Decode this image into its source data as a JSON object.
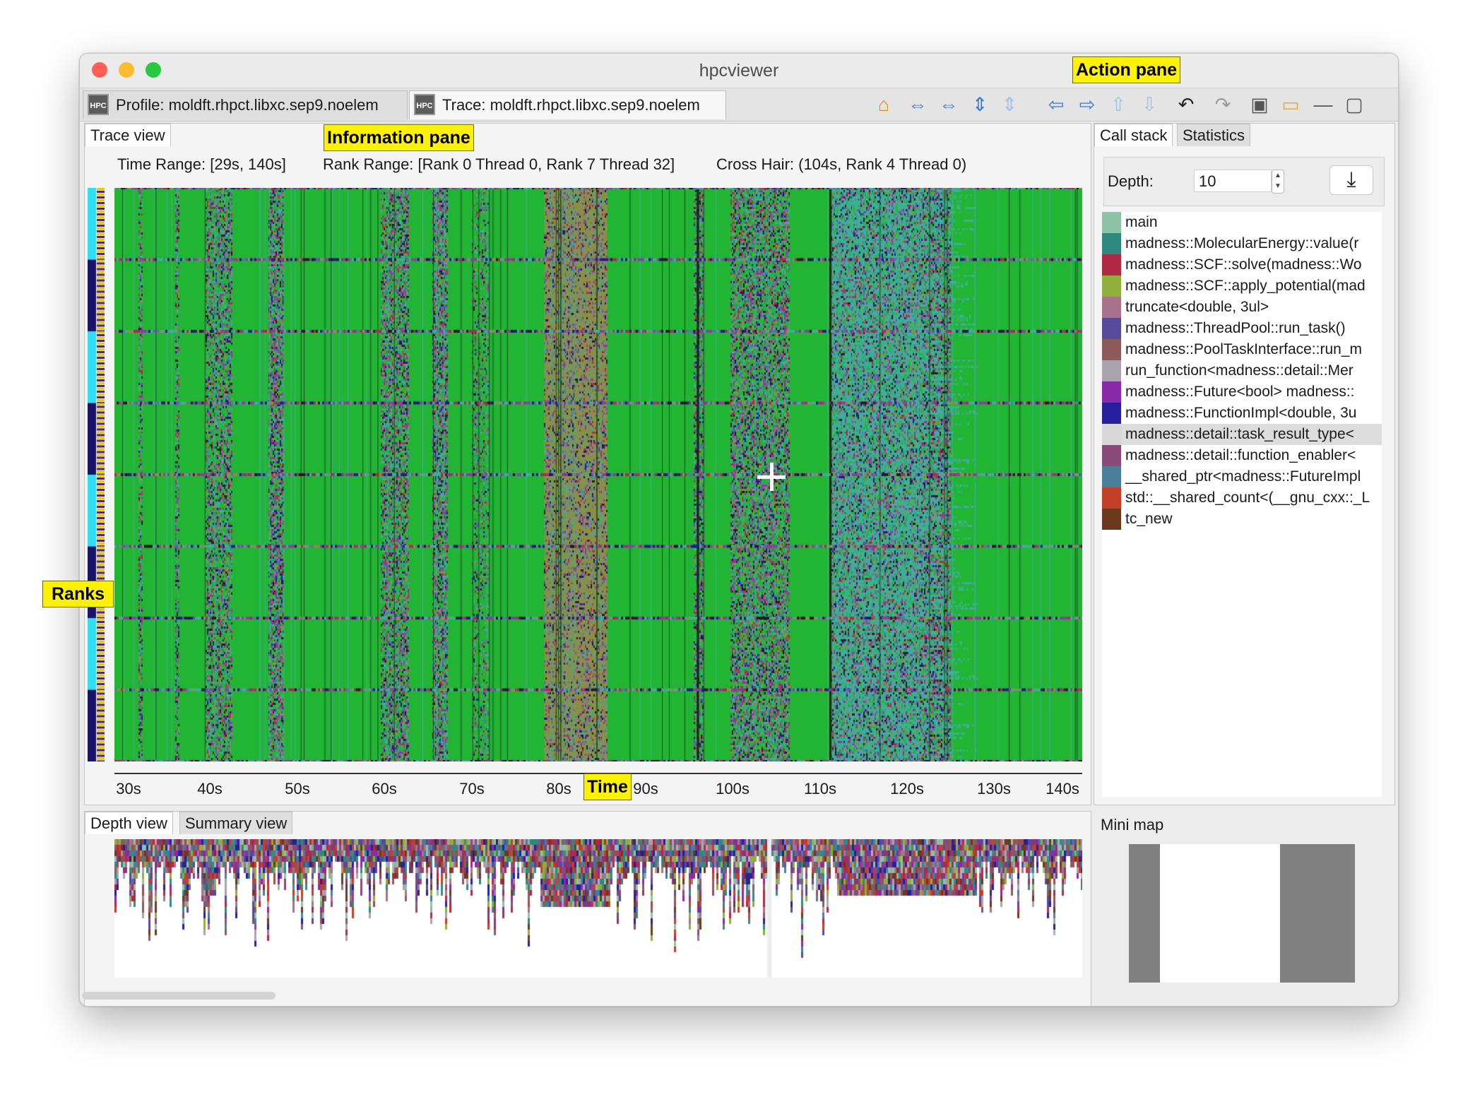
{
  "window": {
    "title": "hpcviewer",
    "traffic_lights": {
      "close": "#ff5f57",
      "minimize": "#febc2e",
      "zoom": "#28c840"
    }
  },
  "tabs": [
    {
      "label": "Profile: moldft.rhpct.libxc.sep9.noelem",
      "icon": "hpc-icon",
      "active": false
    },
    {
      "label": "Trace: moldft.rhpct.libxc.sep9.noelem",
      "icon": "hpc-icon",
      "active": true
    }
  ],
  "toolbar": {
    "buttons": [
      {
        "name": "home-icon"
      },
      {
        "name": "zoom-in-time-icon"
      },
      {
        "name": "zoom-out-time-icon"
      },
      {
        "name": "zoom-in-rank-icon"
      },
      {
        "name": "zoom-out-rank-icon"
      },
      {
        "name": "arrow-left-icon"
      },
      {
        "name": "arrow-right-icon"
      },
      {
        "name": "arrow-up-icon"
      },
      {
        "name": "arrow-down-icon"
      },
      {
        "name": "undo-icon"
      },
      {
        "name": "redo-icon"
      },
      {
        "name": "save-icon"
      },
      {
        "name": "open-folder-icon"
      },
      {
        "name": "minimize-icon"
      },
      {
        "name": "maximize-icon"
      }
    ]
  },
  "annotations": {
    "action_pane": "Action pane",
    "information_pane": "Information pane",
    "ranks": "Ranks",
    "time": "Time"
  },
  "trace_view": {
    "tab_label": "Trace view",
    "time_range": "Time Range: [29s, 140s]",
    "rank_range": "Rank Range: [Rank 0 Thread 0, Rank 7 Thread 32]",
    "cross_hair": "Cross Hair: (104s, Rank 4 Thread 0)",
    "x_ticks": [
      "30s",
      "40s",
      "50s",
      "60s",
      "70s",
      "80s",
      "90s",
      "100s",
      "110s",
      "120s",
      "130s",
      "140s"
    ],
    "colors": {
      "green": "#22b534",
      "olive": "#8a8f45",
      "teal": "#3fae98",
      "navy": "#221b8a",
      "purple": "#8a3fa0",
      "rank_cyan": "#2ee0f5",
      "rank_navy": "#1a1466"
    }
  },
  "bottom_panel": {
    "tabs": [
      "Depth view",
      "Summary view"
    ],
    "active_tab": "Depth view"
  },
  "call_stack": {
    "tabs": [
      "Call stack",
      "Statistics"
    ],
    "active_tab": "Call stack",
    "depth_label": "Depth:",
    "depth_value": "10",
    "items": [
      {
        "label": "main",
        "color": "#8ec3a8"
      },
      {
        "label": "madness::MolecularEnergy::value(r",
        "color": "#2e8a80"
      },
      {
        "label": "madness::SCF::solve(madness::Wo",
        "color": "#b02a45"
      },
      {
        "label": "madness::SCF::apply_potential(mad",
        "color": "#8fae3a"
      },
      {
        "label": "truncate<double, 3ul>",
        "color": "#a8728a"
      },
      {
        "label": "madness::ThreadPool::run_task()",
        "color": "#574a9a"
      },
      {
        "label": "madness::PoolTaskInterface::run_m",
        "color": "#8e5a5a"
      },
      {
        "label": "run_function<madness::detail::Mer",
        "color": "#a8a3ad"
      },
      {
        "label": "madness::Future<bool> madness::",
        "color": "#8a2aa8"
      },
      {
        "label": "madness::FunctionImpl<double, 3u",
        "color": "#271f9c"
      },
      {
        "label": "madness::detail::task_result_type<",
        "color": "#d8d8d8",
        "selected": true
      },
      {
        "label": "madness::detail::function_enabler<",
        "color": "#8a4a7a"
      },
      {
        "label": "__shared_ptr<madness::FutureImpl",
        "color": "#4a7f9a"
      },
      {
        "label": "std::__shared_count<(__gnu_cxx::_L",
        "color": "#c2402a"
      },
      {
        "label": "tc_new",
        "color": "#6b3a1e"
      }
    ]
  },
  "mini_map": {
    "label": "Mini map"
  }
}
